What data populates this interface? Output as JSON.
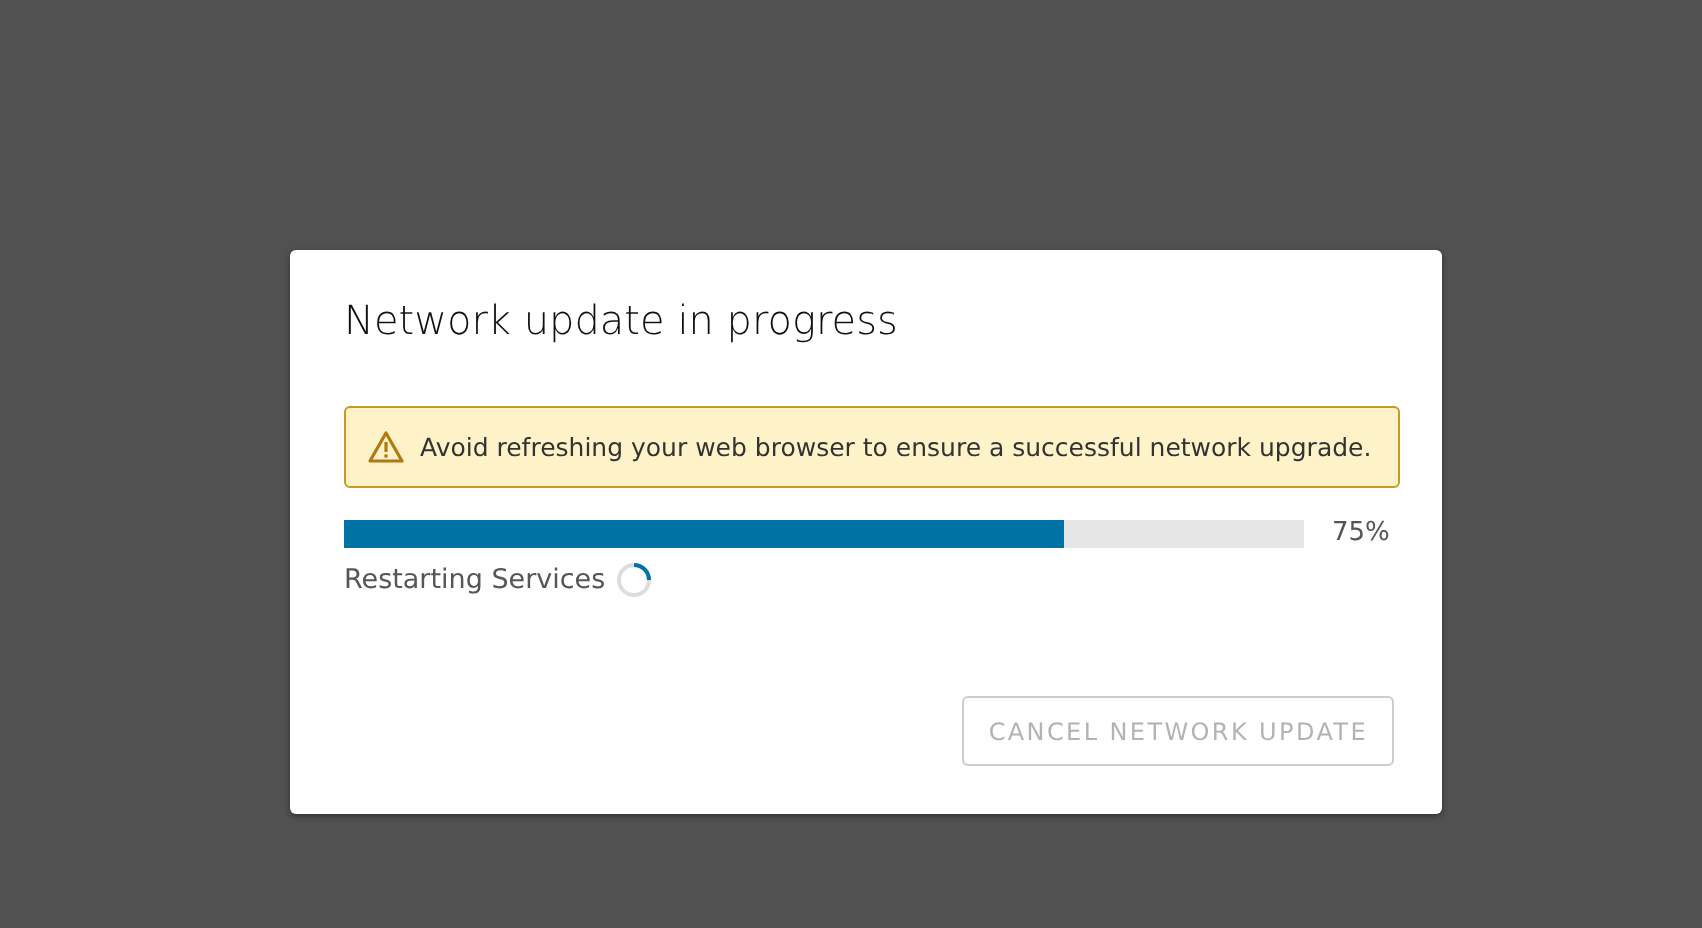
{
  "dialog": {
    "title": "Network update in progress",
    "alert": {
      "kind": "warning",
      "text": "Avoid refreshing your web browser to ensure a successful network upgrade."
    },
    "progress": {
      "level": 0.75,
      "reading": "75%"
    },
    "status": {
      "text": "Restarting Services",
      "busy": true
    },
    "buttons": [
      {
        "label": "CANCEL NETWORK UPDATE",
        "disabled": true
      }
    ]
  }
}
